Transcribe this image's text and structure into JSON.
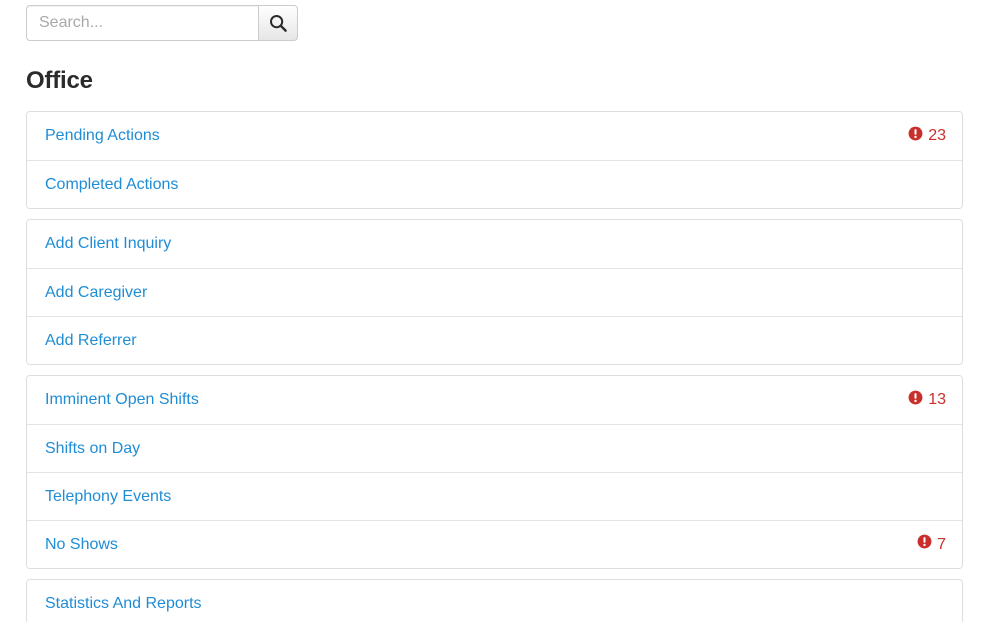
{
  "search": {
    "placeholder": "Search...",
    "value": "",
    "button_icon": "search-icon",
    "button_label": ""
  },
  "heading": {
    "title": "Office"
  },
  "colors": {
    "link": "#1f8dd6",
    "badge": "#c9302c",
    "border": "#dddddd",
    "divider": "#e3e3e3",
    "heading": "#2b2b2b",
    "placeholder": "#a9a9a9"
  },
  "groups": [
    {
      "name": "actions-group",
      "items": [
        {
          "label": "Pending Actions",
          "badge": "23",
          "badge_icon": "exclamation-circle-icon",
          "has_badge": true
        },
        {
          "label": "Completed Actions",
          "badge": "",
          "badge_icon": "",
          "has_badge": false
        }
      ]
    },
    {
      "name": "add-records-group",
      "items": [
        {
          "label": "Add Client Inquiry",
          "badge": "",
          "badge_icon": "",
          "has_badge": false
        },
        {
          "label": "Add Caregiver",
          "badge": "",
          "badge_icon": "",
          "has_badge": false
        },
        {
          "label": "Add Referrer",
          "badge": "",
          "badge_icon": "",
          "has_badge": false
        }
      ]
    },
    {
      "name": "shifts-group",
      "items": [
        {
          "label": "Imminent Open Shifts",
          "badge": "13",
          "badge_icon": "exclamation-circle-icon",
          "has_badge": true
        },
        {
          "label": "Shifts on Day",
          "badge": "",
          "badge_icon": "",
          "has_badge": false
        },
        {
          "label": "Telephony Events",
          "badge": "",
          "badge_icon": "",
          "has_badge": false
        },
        {
          "label": "No Shows",
          "badge": "7",
          "badge_icon": "exclamation-circle-icon",
          "has_badge": true
        }
      ]
    },
    {
      "name": "reports-group",
      "items": [
        {
          "label": "Statistics And Reports",
          "badge": "",
          "badge_icon": "",
          "has_badge": false
        }
      ]
    }
  ]
}
